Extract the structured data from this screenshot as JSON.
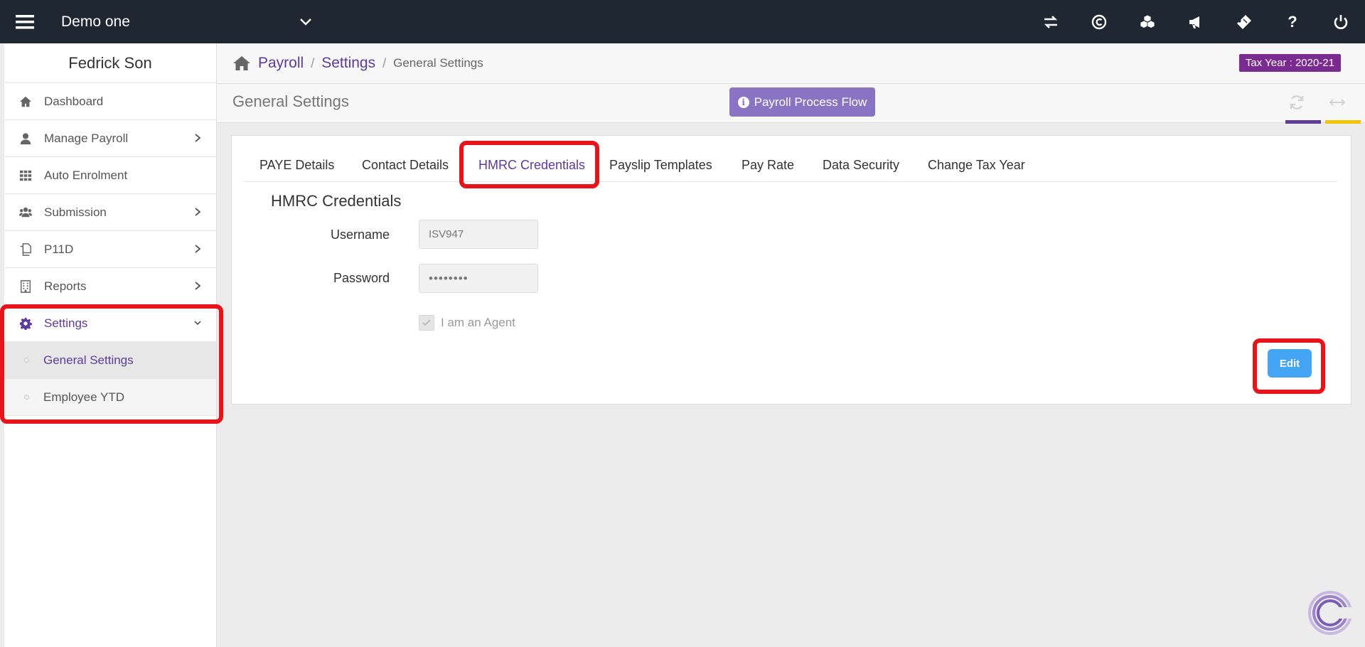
{
  "topbar": {
    "company": "Demo one",
    "icons": [
      "switch-icon",
      "copyright-icon",
      "boxes-icon",
      "megaphone-icon",
      "ticket-icon",
      "help-icon",
      "power-icon"
    ],
    "help_glyph": "?"
  },
  "sidebar": {
    "user": "Fedrick Son",
    "items": [
      {
        "label": "Dashboard",
        "icon": "home-icon"
      },
      {
        "label": "Manage Payroll",
        "icon": "user-icon"
      },
      {
        "label": "Auto Enrolment",
        "icon": "grid-icon"
      },
      {
        "label": "Submission",
        "icon": "users-icon"
      },
      {
        "label": "P11D",
        "icon": "copy-icon"
      },
      {
        "label": "Reports",
        "icon": "building-icon"
      },
      {
        "label": "Settings",
        "icon": "gear-icon"
      }
    ],
    "subitems": [
      {
        "label": "General Settings"
      },
      {
        "label": "Employee YTD"
      }
    ]
  },
  "breadcrumb": {
    "items": [
      "Payroll",
      "Settings"
    ],
    "current": "General Settings",
    "separator": "/"
  },
  "tax_year": "Tax Year : 2020-21",
  "page": {
    "title": "General Settings",
    "flow_button": "Payroll Process Flow"
  },
  "tabs": [
    "PAYE Details",
    "Contact Details",
    "HMRC Credentials",
    "Payslip Templates",
    "Pay Rate",
    "Data Security",
    "Change Tax Year"
  ],
  "active_tab": "HMRC Credentials",
  "form": {
    "title": "HMRC Credentials",
    "username_label": "Username",
    "username_value": "ISV947",
    "password_label": "Password",
    "password_value": "••••••••",
    "agent_label": "I am an Agent",
    "agent_checked": true,
    "edit_label": "Edit"
  },
  "colors": {
    "accent": "#5d3b96",
    "topbar": "#1f2733",
    "highlight": "#e8141b",
    "edit_button": "#45a5f5",
    "tax_badge": "#7b2a8f"
  }
}
